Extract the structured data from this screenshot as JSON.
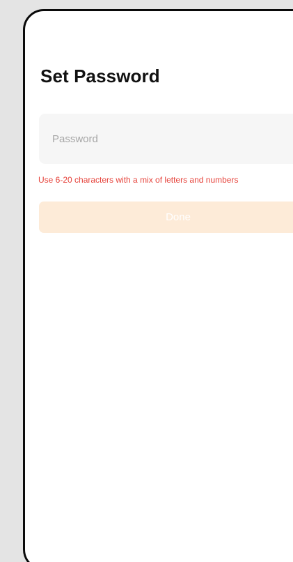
{
  "page": {
    "title": "Set Password"
  },
  "password_field": {
    "placeholder": "Password",
    "value": ""
  },
  "hint": {
    "text": "Use 6-20 characters with a mix of letters and numbers",
    "color": "#e6433b"
  },
  "done_button": {
    "label": "Done",
    "state": "disabled",
    "background": "#fdebd8"
  },
  "colors": {
    "backdrop": "#e4e4e4",
    "screen": "#ffffff",
    "frame": "#0a0a0a"
  }
}
